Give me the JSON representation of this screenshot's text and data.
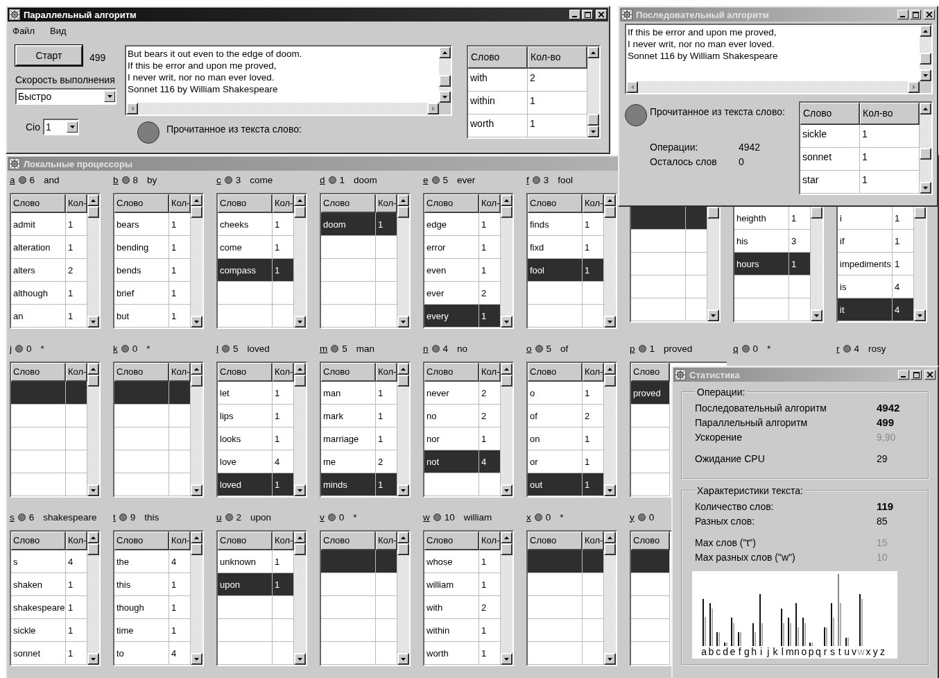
{
  "parallel_window": {
    "title": "Параллельный алгоритм",
    "active": true,
    "menu": [
      "Файл",
      "Вид"
    ],
    "start_button": "Старт",
    "operations": "499",
    "speed_label": "Скорость выполнения",
    "speed_value": "Быстро",
    "cio_label": "Cio",
    "cio_value": "1",
    "text_lines": [
      "But bears it out even to the edge of doom.",
      "If this be error and upon me proved,",
      "I never writ, nor no man ever loved.",
      "Sonnet 116 by William Shakespeare"
    ],
    "indicator_label": "Прочитанное из текста слово:",
    "table": {
      "columns": [
        "Слово",
        "Кол-во"
      ],
      "rows": [
        {
          "word": "with",
          "count": "2",
          "selected": false
        },
        {
          "word": "within",
          "count": "1",
          "selected": false
        },
        {
          "word": "worth",
          "count": "1",
          "selected": false
        }
      ]
    }
  },
  "sequential_window": {
    "title": "Последовательный алгоритм",
    "active": false,
    "text_lines": [
      "If this be error and upon me proved,",
      "I never writ, nor no man ever loved.",
      "Sonnet 116 by William Shakespeare"
    ],
    "indicator_label": "Прочитанное из текста слово:",
    "operations_label": "Операции:",
    "operations": "4942",
    "remaining_label": "Осталось слов",
    "remaining": "0",
    "table": {
      "columns": [
        "Слово",
        "Кол-во"
      ],
      "rows": [
        {
          "word": "sickle",
          "count": "1",
          "selected": false
        },
        {
          "word": "sonnet",
          "count": "1",
          "selected": false
        },
        {
          "word": "star",
          "count": "1",
          "selected": false
        }
      ]
    }
  },
  "processors_window": {
    "title": "Локальные процессоры",
    "active": false,
    "processors": [
      {
        "letter": "a",
        "count": "6",
        "word": "and",
        "table": {
          "columns": [
            "Слово",
            "Кол-"
          ],
          "rows": [
            {
              "word": "admit",
              "count": "1",
              "selected": false
            },
            {
              "word": "alteration",
              "count": "1",
              "selected": false
            },
            {
              "word": "alters",
              "count": "2",
              "selected": false
            },
            {
              "word": "although",
              "count": "1",
              "selected": false
            },
            {
              "word": "an",
              "count": "1",
              "selected": false
            }
          ]
        }
      },
      {
        "letter": "b",
        "count": "8",
        "word": "by",
        "table": {
          "columns": [
            "Слово",
            "Кол-"
          ],
          "rows": [
            {
              "word": "bears",
              "count": "1",
              "selected": false
            },
            {
              "word": "bending",
              "count": "1",
              "selected": false
            },
            {
              "word": "bends",
              "count": "1",
              "selected": false
            },
            {
              "word": "brief",
              "count": "1",
              "selected": false
            },
            {
              "word": "but",
              "count": "1",
              "selected": false
            }
          ]
        }
      },
      {
        "letter": "c",
        "count": "3",
        "word": "come",
        "table": {
          "columns": [
            "Слово",
            "Кол-"
          ],
          "rows": [
            {
              "word": "cheeks",
              "count": "1",
              "selected": false
            },
            {
              "word": "come",
              "count": "1",
              "selected": false
            },
            {
              "word": "compass",
              "count": "1",
              "selected": true
            }
          ]
        }
      },
      {
        "letter": "d",
        "count": "1",
        "word": "doom",
        "table": {
          "columns": [
            "Слово",
            "Кол-"
          ],
          "rows": [
            {
              "word": "doom",
              "count": "1",
              "selected": true
            }
          ]
        }
      },
      {
        "letter": "e",
        "count": "5",
        "word": "ever",
        "table": {
          "columns": [
            "Слово",
            "Кол-"
          ],
          "rows": [
            {
              "word": "edge",
              "count": "1",
              "selected": false
            },
            {
              "word": "error",
              "count": "1",
              "selected": false
            },
            {
              "word": "even",
              "count": "1",
              "selected": false
            },
            {
              "word": "ever",
              "count": "2",
              "selected": false
            },
            {
              "word": "every",
              "count": "1",
              "selected": true
            }
          ]
        }
      },
      {
        "letter": "f",
        "count": "3",
        "word": "fool",
        "table": {
          "columns": [
            "Слово",
            "Кол-"
          ],
          "rows": [
            {
              "word": "finds",
              "count": "1",
              "selected": false
            },
            {
              "word": "fixd",
              "count": "1",
              "selected": false
            },
            {
              "word": "fool",
              "count": "1",
              "selected": true
            }
          ]
        }
      },
      {
        "table": {
          "rows": [
            {
              "selected": true
            }
          ]
        }
      },
      {
        "table": {
          "rows": [
            {
              "word": "heighth",
              "count": "1",
              "selected": false
            },
            {
              "word": "his",
              "count": "3",
              "selected": false
            },
            {
              "word": "hours",
              "count": "1",
              "selected": true
            }
          ]
        }
      },
      {
        "table": {
          "rows": [
            {
              "word": "i",
              "count": "1",
              "selected": false
            },
            {
              "word": "if",
              "count": "1",
              "selected": false
            },
            {
              "word": "impediments",
              "count": "1",
              "selected": false
            },
            {
              "word": "is",
              "count": "4",
              "selected": false
            },
            {
              "word": "it",
              "count": "4",
              "selected": true
            }
          ]
        }
      },
      {
        "letter": "j",
        "count": "0",
        "word": "*",
        "table": {
          "columns": [
            "Слово",
            "Кол-"
          ],
          "rows": [
            {
              "selected": true
            }
          ]
        }
      },
      {
        "letter": "k",
        "count": "0",
        "word": "*",
        "table": {
          "columns": [
            "Слово",
            "Кол-"
          ],
          "rows": [
            {
              "selected": true
            }
          ]
        }
      },
      {
        "letter": "l",
        "count": "5",
        "word": "loved",
        "table": {
          "columns": [
            "Слово",
            "Кол-"
          ],
          "rows": [
            {
              "word": "let",
              "count": "1",
              "selected": false
            },
            {
              "word": "lips",
              "count": "1",
              "selected": false
            },
            {
              "word": "looks",
              "count": "1",
              "selected": false
            },
            {
              "word": "love",
              "count": "4",
              "selected": false
            },
            {
              "word": "loved",
              "count": "1",
              "selected": true
            }
          ]
        }
      },
      {
        "letter": "m",
        "count": "5",
        "word": "man",
        "table": {
          "columns": [
            "Слово",
            "Кол-"
          ],
          "rows": [
            {
              "word": "man",
              "count": "1",
              "selected": false
            },
            {
              "word": "mark",
              "count": "1",
              "selected": false
            },
            {
              "word": "marriage",
              "count": "1",
              "selected": false
            },
            {
              "word": "me",
              "count": "2",
              "selected": false
            },
            {
              "word": "minds",
              "count": "1",
              "selected": true
            }
          ]
        }
      },
      {
        "letter": "n",
        "count": "4",
        "word": "no",
        "table": {
          "columns": [
            "Слово",
            "Кол-"
          ],
          "rows": [
            {
              "word": "never",
              "count": "2",
              "selected": false
            },
            {
              "word": "no",
              "count": "2",
              "selected": false
            },
            {
              "word": "nor",
              "count": "1",
              "selected": false
            },
            {
              "word": "not",
              "count": "4",
              "selected": true
            }
          ]
        }
      },
      {
        "letter": "o",
        "count": "5",
        "word": "of",
        "table": {
          "columns": [
            "Слово",
            "Кол-"
          ],
          "rows": [
            {
              "word": "o",
              "count": "1",
              "selected": false
            },
            {
              "word": "of",
              "count": "2",
              "selected": false
            },
            {
              "word": "on",
              "count": "1",
              "selected": false
            },
            {
              "word": "or",
              "count": "1",
              "selected": false
            },
            {
              "word": "out",
              "count": "1",
              "selected": true
            }
          ]
        }
      },
      {
        "letter": "p",
        "count": "1",
        "word": "proved",
        "table": {
          "columns": [
            "Слово"
          ],
          "rows": [
            {
              "word": "proved",
              "selected": true
            }
          ]
        }
      },
      {
        "letter": "q",
        "count": "0",
        "word": "*"
      },
      {
        "letter": "r",
        "count": "4",
        "word": "rosy"
      },
      {
        "letter": "s",
        "count": "6",
        "word": "shakespeare",
        "table": {
          "columns": [
            "Слово",
            "Кол-"
          ],
          "rows": [
            {
              "word": "s",
              "count": "4",
              "selected": false
            },
            {
              "word": "shaken",
              "count": "1",
              "selected": false
            },
            {
              "word": "shakespeare",
              "count": "1",
              "selected": false
            },
            {
              "word": "sickle",
              "count": "1",
              "selected": false
            },
            {
              "word": "sonnet",
              "count": "1",
              "selected": false
            }
          ]
        }
      },
      {
        "letter": "t",
        "count": "9",
        "word": "this",
        "table": {
          "columns": [
            "Слово",
            "Кол-"
          ],
          "rows": [
            {
              "word": "the",
              "count": "4",
              "selected": false
            },
            {
              "word": "this",
              "count": "1",
              "selected": false
            },
            {
              "word": "though",
              "count": "1",
              "selected": false
            },
            {
              "word": "time",
              "count": "1",
              "selected": false
            },
            {
              "word": "to",
              "count": "4",
              "selected": false
            }
          ]
        }
      },
      {
        "letter": "u",
        "count": "2",
        "word": "upon",
        "table": {
          "columns": [
            "Слово",
            "Кол-"
          ],
          "rows": [
            {
              "word": "unknown",
              "count": "1",
              "selected": false
            },
            {
              "word": "upon",
              "count": "1",
              "selected": true
            }
          ]
        }
      },
      {
        "letter": "v",
        "count": "0",
        "word": "*",
        "table": {
          "columns": [
            "Слово",
            "Кол-"
          ],
          "rows": [
            {
              "selected": true
            }
          ]
        }
      },
      {
        "letter": "w",
        "count": "10",
        "word": "william",
        "table": {
          "columns": [
            "Слово",
            "Кол-"
          ],
          "rows": [
            {
              "word": "whose",
              "count": "1",
              "selected": false
            },
            {
              "word": "william",
              "count": "1",
              "selected": false
            },
            {
              "word": "with",
              "count": "2",
              "selected": false
            },
            {
              "word": "within",
              "count": "1",
              "selected": false
            },
            {
              "word": "worth",
              "count": "1",
              "selected": false
            }
          ]
        }
      },
      {
        "letter": "x",
        "count": "0",
        "word": "*",
        "table": {
          "columns": [
            "Слово",
            "Кол-"
          ],
          "rows": [
            {
              "selected": true
            }
          ]
        }
      },
      {
        "letter": "y",
        "count": "0",
        "table": {
          "columns": [
            "Слово"
          ],
          "rows": [
            {
              "selected": true
            }
          ]
        }
      }
    ]
  },
  "statistics_window": {
    "title": "Статистика",
    "active": false,
    "groups": [
      {
        "title": "Операции:",
        "blocks": [
          [
            {
              "label": "Последовательный алгоритм",
              "value": "4942",
              "kind": "bold"
            },
            {
              "label": "Параллельный алгоритм",
              "value": "499",
              "kind": "bold"
            },
            {
              "label": "Ускорение",
              "value": "9,90",
              "kind": "dim"
            }
          ],
          [
            {
              "label": "Ожидание CPU",
              "value": "29",
              "kind": "plain"
            }
          ]
        ]
      },
      {
        "title": "Характеристики текста:",
        "blocks": [
          [
            {
              "label": "Количество слов:",
              "value": "119",
              "kind": "bold"
            },
            {
              "label": "Разных слов:",
              "value": "85",
              "kind": "plain"
            }
          ],
          [
            {
              "label": "Max слов (\"t\")",
              "value": "15",
              "kind": "dim"
            },
            {
              "label": "Max разных слов (\"w\")",
              "value": "10",
              "kind": "dim"
            }
          ]
        ]
      }
    ],
    "histogram_letters": [
      {
        "letter": "a",
        "dim": false
      },
      {
        "letter": "b",
        "dim": false
      },
      {
        "letter": "c",
        "dim": false
      },
      {
        "letter": "d",
        "dim": false
      },
      {
        "letter": "e",
        "dim": false
      },
      {
        "letter": "f",
        "dim": false
      },
      {
        "letter": "g",
        "dim": false
      },
      {
        "letter": "h",
        "dim": false
      },
      {
        "letter": "i",
        "dim": false
      },
      {
        "letter": "j",
        "dim": false
      },
      {
        "letter": "k",
        "dim": false
      },
      {
        "letter": "l",
        "dim": false
      },
      {
        "letter": "m",
        "dim": false
      },
      {
        "letter": "n",
        "dim": false
      },
      {
        "letter": "o",
        "dim": false
      },
      {
        "letter": "p",
        "dim": false
      },
      {
        "letter": "q",
        "dim": false
      },
      {
        "letter": "r",
        "dim": false
      },
      {
        "letter": "s",
        "dim": false
      },
      {
        "letter": "t",
        "dim": false
      },
      {
        "letter": "u",
        "dim": false
      },
      {
        "letter": "v",
        "dim": false
      },
      {
        "letter": "w",
        "dim": true
      },
      {
        "letter": "x",
        "dim": false
      },
      {
        "letter": "y",
        "dim": false
      },
      {
        "letter": "z",
        "dim": false
      }
    ]
  }
}
